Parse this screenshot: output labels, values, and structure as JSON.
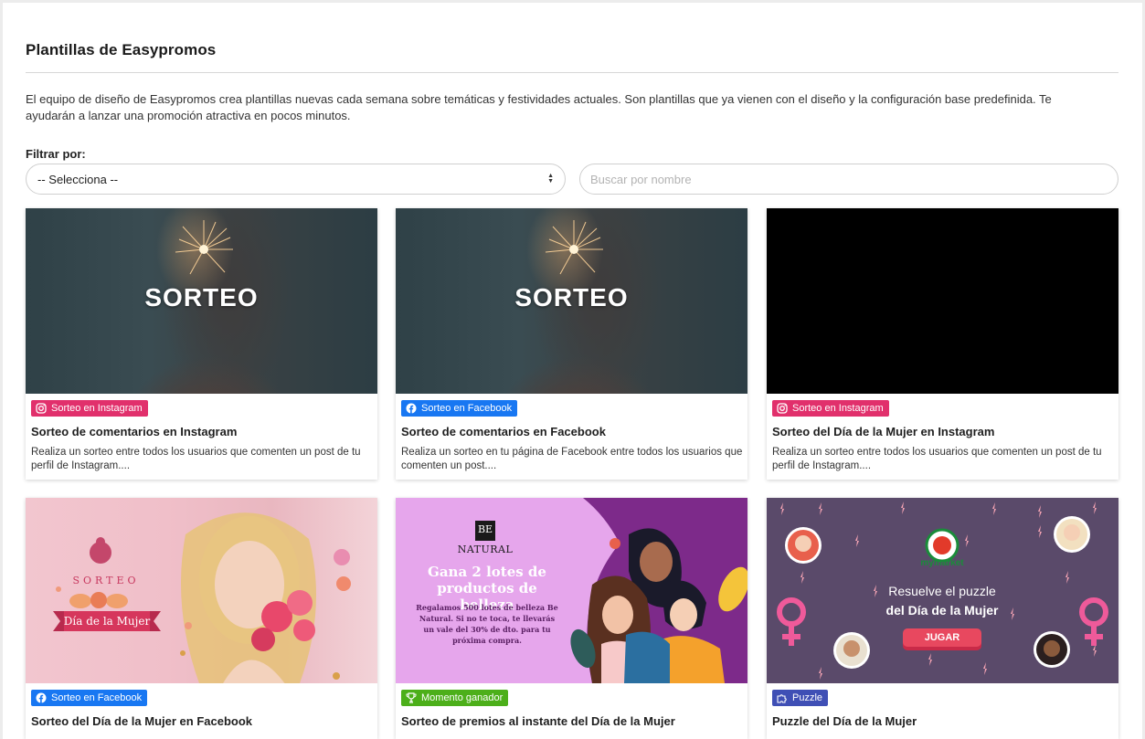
{
  "page": {
    "title": "Plantillas de Easypromos",
    "intro": "El equipo de diseño de Easypromos crea plantillas nuevas cada semana sobre temáticas y festividades actuales. Son plantillas que ya vienen con el diseño y la configuración base predefinida. Te ayudarán a lanzar una promoción atractiva en pocos minutos."
  },
  "filter": {
    "label": "Filtrar por:",
    "select_value": "-- Selecciona --",
    "search_placeholder": "Buscar por nombre"
  },
  "colors": {
    "instagram": "#e1306c",
    "facebook": "#1877f2",
    "instant_win": "#4caf1a",
    "puzzle": "#3f4fb5"
  },
  "cards": [
    {
      "badge": "Sorteo en Instagram",
      "badge_icon": "instagram-icon",
      "thumb_text": "SORTEO",
      "title": "Sorteo de comentarios en Instagram",
      "desc": "Realiza un sorteo entre todos los usuarios que comenten un post de tu perfil de Instagram...."
    },
    {
      "badge": "Sorteo en Facebook",
      "badge_icon": "facebook-icon",
      "thumb_text": "SORTEO",
      "title": "Sorteo de comentarios en Facebook",
      "desc": "Realiza un sorteo en tu página de Facebook entre todos los usuarios que comenten un post...."
    },
    {
      "badge": "Sorteo en Instagram",
      "badge_icon": "instagram-icon",
      "title": "Sorteo del Día de la Mujer en Instagram",
      "desc": "Realiza un sorteo entre todos los usuarios que comenten un post de tu perfil de Instagram...."
    },
    {
      "badge": "Sorteo en Facebook",
      "badge_icon": "facebook-icon",
      "thumb_small": "SORTEO",
      "thumb_banner": "Día de la Mujer",
      "title": "Sorteo del Día de la Mujer en Facebook"
    },
    {
      "badge": "Momento ganador",
      "badge_icon": "trophy-icon",
      "thumb_logo_top": "BE",
      "thumb_logo_bottom": "NATURAL",
      "thumb_headline": "Gana 2 lotes de productos de belleza",
      "thumb_body": "Regalamos 500 lotes de belleza Be Natural. Si no te toca, te llevarás un vale del 30% de dto. para tu próxima compra.",
      "title": "Sorteo de premios al instante del Día de la Mujer"
    },
    {
      "badge": "Puzzle",
      "badge_icon": "puzzle-icon",
      "thumb_brand": "mymarket",
      "thumb_line1": "Resuelve el puzzle",
      "thumb_line2": "del Día de la Mujer",
      "thumb_button": "JUGAR",
      "title": "Puzzle del Día de la Mujer"
    }
  ]
}
